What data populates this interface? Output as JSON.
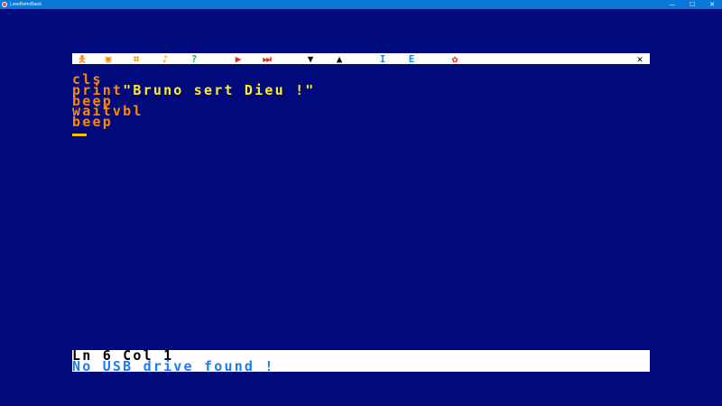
{
  "window": {
    "title": "LoveRetroBasic",
    "minimize_glyph": "—",
    "maximize_glyph": "☐",
    "close_glyph": "✕"
  },
  "toolbar": {
    "icons": [
      {
        "name": "run-man-icon",
        "glyph": "🯅",
        "color": "#ff8800"
      },
      {
        "name": "sprite-editor-icon",
        "glyph": "▣",
        "color": "#ff8800"
      },
      {
        "name": "tile-editor-icon",
        "glyph": "⌗",
        "color": "#ff8800"
      },
      {
        "name": "music-note-icon",
        "glyph": "♪",
        "color": "#ff8800"
      },
      {
        "name": "help-icon",
        "glyph": "?",
        "color": "#22aa44"
      },
      {
        "name": "run-icon",
        "glyph": "▶",
        "color": "#ee2222"
      },
      {
        "name": "step-icon",
        "glyph": "⏭",
        "color": "#ee2222"
      },
      {
        "name": "load-icon",
        "glyph": "▼",
        "color": "#111111"
      },
      {
        "name": "save-icon",
        "glyph": "▲",
        "color": "#111111"
      },
      {
        "name": "import-icon",
        "glyph": "I",
        "color": "#1a88ee"
      },
      {
        "name": "export-icon",
        "glyph": "E",
        "color": "#1a88ee"
      },
      {
        "name": "settings-icon",
        "glyph": "✿",
        "color": "#ee2222"
      },
      {
        "name": "close-icon",
        "glyph": "✕",
        "color": "#000000"
      }
    ]
  },
  "editor": {
    "lines": [
      {
        "keyword": "cls",
        "arg": ""
      },
      {
        "keyword": "print",
        "arg": "\"Bruno sert Dieu !\""
      },
      {
        "keyword": "beep",
        "arg": ""
      },
      {
        "keyword": "waitvbl",
        "arg": ""
      },
      {
        "keyword": "beep",
        "arg": ""
      }
    ]
  },
  "status": {
    "position": "Ln 6 Col 1",
    "message": "No USB drive found !"
  },
  "colors": {
    "background": "#000a7c",
    "keyword": "#ff8800",
    "string": "#ffee22",
    "status_message": "#1a7cf0"
  }
}
